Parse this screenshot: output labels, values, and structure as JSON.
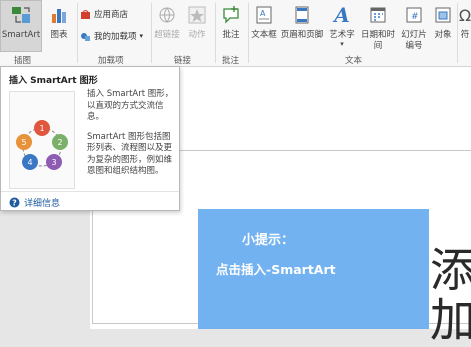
{
  "ribbon": {
    "smartart_label": "SmartArt",
    "chart_label": "图表",
    "group_illustrations": "插图",
    "app_store_label": "应用商店",
    "my_addins_label": "我的加载项",
    "group_addins": "加载项",
    "hyperlink_label": "超链接",
    "action_label": "动作",
    "group_links": "链接",
    "comment_label": "批注",
    "group_comments": "批注",
    "textbox_label": "文本框",
    "header_footer_label": "页眉和页脚",
    "wordart_label": "艺术字",
    "datetime_label": "日期和时间",
    "slide_number_label": "幻灯片编号",
    "object_label": "对象",
    "group_text": "文本",
    "symbol_label": "符"
  },
  "tooltip": {
    "title": "插入 SmartArt 图形",
    "desc1": "插入 SmartArt 图形，以直观的方式交流信息。",
    "desc2": "SmartArt 图形包括图形列表、流程图以及更为复杂的图形，例如维恩图和组织结构图。",
    "more_label": "详细信息",
    "thumb_numbers": [
      "1",
      "2",
      "3",
      "4",
      "5"
    ]
  },
  "hint": {
    "line1": "小提示：",
    "line2": "点击插入-SmartArt"
  },
  "slide": {
    "partial_text": "添加"
  },
  "colors": {
    "hint_bg": "#73b2f0",
    "smartart_selected_bg": "#d6d6d6",
    "link_blue": "#1e5aa0"
  }
}
